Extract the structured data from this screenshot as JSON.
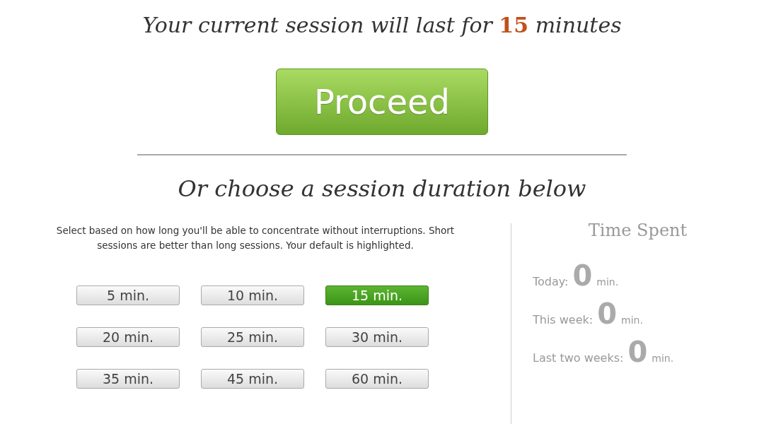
{
  "headline": "Your current session will last for **15** minutes",
  "proceed": "Proceed",
  "subheading": "Or choose a session duration below",
  "instructions": "Select based on how long you'll be able to concentrate without interruptions. Short sessions are better than long sessions. Your default is highlighted.",
  "durations": [
    {
      "label": "5 min.",
      "selected": false
    },
    {
      "label": "10 min.",
      "selected": false
    },
    {
      "label": "15 min.",
      "selected": true
    },
    {
      "label": "20 min.",
      "selected": false
    },
    {
      "label": "25 min.",
      "selected": false
    },
    {
      "label": "30 min.",
      "selected": false
    },
    {
      "label": "35 min.",
      "selected": false
    },
    {
      "label": "45 min.",
      "selected": false
    },
    {
      "label": "60 min.",
      "selected": false
    }
  ],
  "time_spent": {
    "title": "Time Spent",
    "stats": [
      {
        "label": "Today:",
        "value": "0",
        "unit": "min."
      },
      {
        "label": "This week:",
        "value": "0",
        "unit": "min."
      },
      {
        "label": "Last two weeks:",
        "value": "0",
        "unit": "min."
      }
    ]
  }
}
